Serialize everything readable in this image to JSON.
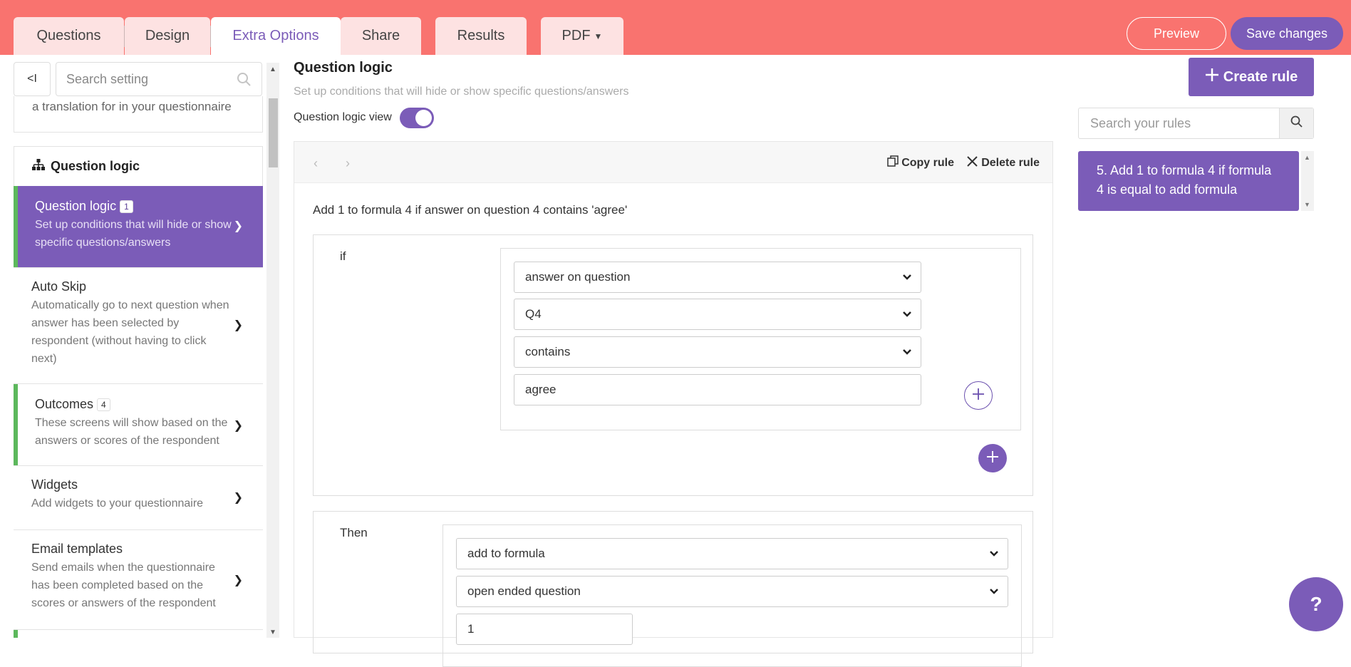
{
  "tabs": {
    "questions": "Questions",
    "design": "Design",
    "extra_options": "Extra Options",
    "share": "Share",
    "results": "Results",
    "pdf": "PDF"
  },
  "header_buttons": {
    "preview": "Preview",
    "save": "Save changes"
  },
  "sidebar": {
    "collapse_label": "<I",
    "search_placeholder": "Search setting",
    "prev_card_text": "a translation for in your questionnaire",
    "group_title": "Question logic",
    "items": [
      {
        "title": "Question logic",
        "badge": "1",
        "desc": "Set up conditions that will hide or show specific questions/answers"
      },
      {
        "title": "Auto Skip",
        "desc": "Automatically go to next question when answer has been selected by respondent (without having to click next)"
      },
      {
        "title": "Outcomes",
        "badge": "4",
        "desc": "These screens will show based on the answers or scores of the respondent"
      },
      {
        "title": "Widgets",
        "desc": "Add widgets to your questionnaire"
      },
      {
        "title": "Email templates",
        "desc": "Send emails when the questionnaire has been completed based on the scores or answers of the respondent"
      }
    ]
  },
  "main": {
    "title": "Question logic",
    "subtitle": "Set up conditions that will hide or show specific questions/answers",
    "view_toggle_label": "Question logic view",
    "view_toggle_on": true,
    "copy_rule": "Copy rule",
    "delete_rule": "Delete rule",
    "rule_description": "Add 1 to formula 4 if answer on question 4 contains 'agree'",
    "if_label": "if",
    "conditions": {
      "subject": "answer on question",
      "question": "Q4",
      "operator": "contains",
      "value": "agree"
    },
    "then_label": "Then",
    "actions": {
      "action": "add to formula",
      "target": "open ended question",
      "amount": "1"
    }
  },
  "right_panel": {
    "create_rule": "Create rule",
    "search_placeholder": "Search your rules",
    "rules": [
      {
        "label": "5. Add 1 to formula 4 if formula 4 is equal to add formula"
      }
    ]
  },
  "help_label": "?",
  "colors": {
    "topbar": "#f9736f",
    "accent": "#7b5cb8",
    "tab_inactive": "#fde2e2",
    "indicator": "#5cb85c"
  }
}
